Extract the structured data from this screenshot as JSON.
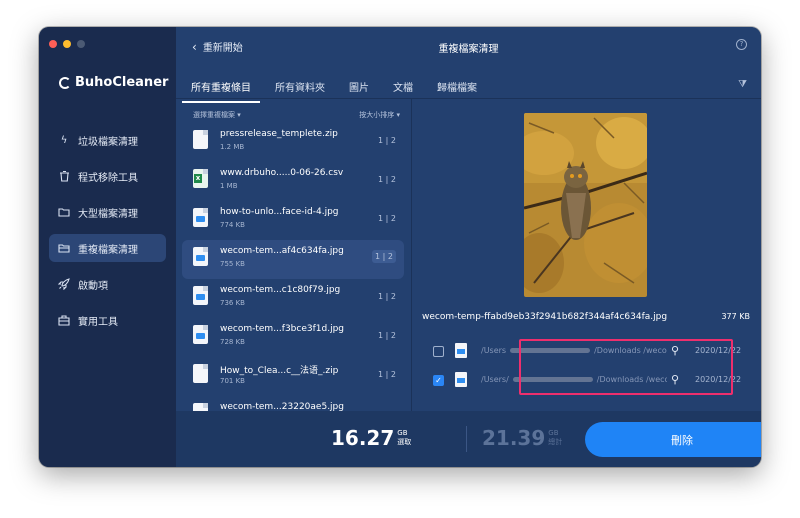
{
  "window": {
    "traffic_lights": [
      "#fe5f57",
      "#febc2e",
      "#2a3a57"
    ]
  },
  "app": {
    "name": "BuhoCleaner"
  },
  "sidebar": {
    "items": [
      {
        "label": "垃圾檔案清理",
        "icon": "lightning-icon"
      },
      {
        "label": "程式移除工具",
        "icon": "trash-icon"
      },
      {
        "label": "大型檔案清理",
        "icon": "folder-icon"
      },
      {
        "label": "重複檔案清理",
        "icon": "duplicate-folder-icon"
      },
      {
        "label": "啟動項",
        "icon": "rocket-icon"
      },
      {
        "label": "實用工具",
        "icon": "toolbox-icon"
      }
    ],
    "active_index": 3
  },
  "header": {
    "back_label": "重新開始",
    "title": "重複檔案清理",
    "help_icon": "help-icon"
  },
  "tabs": [
    "所有重複條目",
    "所有資料夾",
    "圖片",
    "文檔",
    "歸檔檔案"
  ],
  "list_header": {
    "left": "選擇重複檔案",
    "right": "按大小排序"
  },
  "files": [
    {
      "name": "pressrelease_templete.zip",
      "size": "1.2 MB",
      "count": "1 | 2",
      "type": "zip"
    },
    {
      "name": "www.drbuho.....0-06-26.csv",
      "size": "1 MB",
      "count": "1 | 2",
      "type": "csv"
    },
    {
      "name": "how-to-unlo...face-id-4.jpg",
      "size": "774 KB",
      "count": "1 | 2",
      "type": "img"
    },
    {
      "name": "wecom-tem...af4c634fa.jpg",
      "size": "755 KB",
      "count": "1 | 2",
      "type": "img"
    },
    {
      "name": "wecom-tem...c1c80f79.jpg",
      "size": "736 KB",
      "count": "1 | 2",
      "type": "img"
    },
    {
      "name": "wecom-tem...f3bce3f1d.jpg",
      "size": "728 KB",
      "count": "1 | 2",
      "type": "img"
    },
    {
      "name": "How_to_Clea...c__法语_.zip",
      "size": "701 KB",
      "count": "1 | 2",
      "type": "zip"
    },
    {
      "name": "wecom-tem...23220ae5.jpg",
      "size": "",
      "count": "",
      "type": "img"
    }
  ],
  "selected_file_index": 3,
  "detail": {
    "file_name": "wecom-temp-ffabd9eb33f2941b682f344af4c634fa.jpg",
    "file_size": "377 KB",
    "copies": [
      {
        "checked": false,
        "path_start": "/Users",
        "path_end": "/Downloads /wecom-temp",
        "date": "2020/12/22"
      },
      {
        "checked": true,
        "path_start": "/Users/",
        "path_end": "/Downloads /wecom-temp",
        "date": "2020/12/22"
      }
    ]
  },
  "footer": {
    "selected_value": "16.27",
    "selected_unit": "GB",
    "selected_label": "選取",
    "total_value": "21.39",
    "total_unit": "GB",
    "total_label": "總計",
    "delete_label": "刪除"
  }
}
